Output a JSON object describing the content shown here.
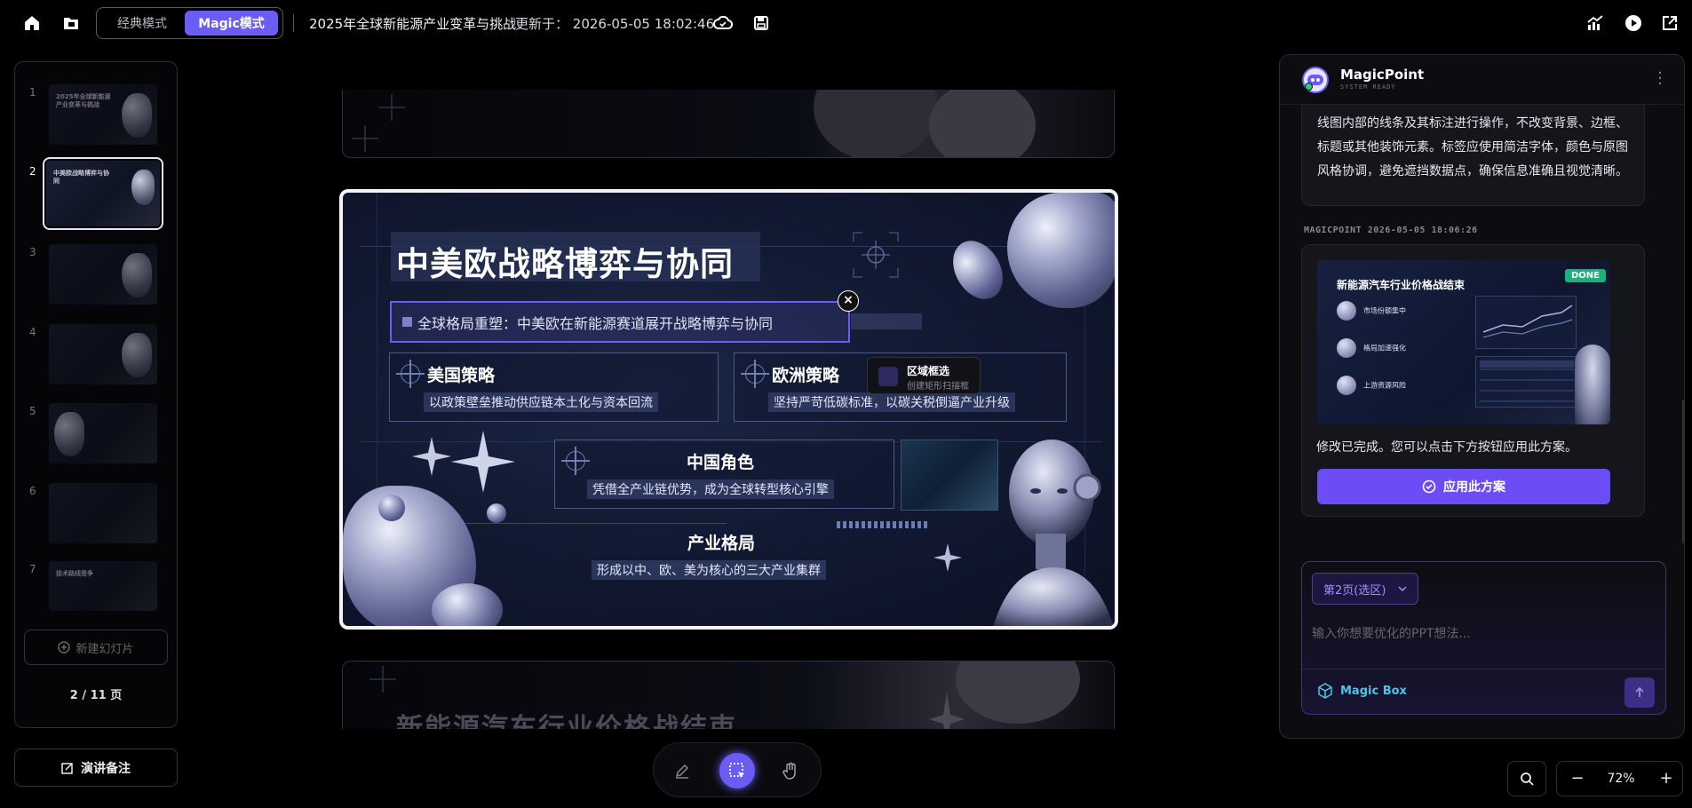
{
  "topbar": {
    "mode_classic": "经典模式",
    "mode_magic": "Magic模式",
    "doc_title": "2025年全球新能源产业变革与挑战",
    "updated_label": "更新于：",
    "updated_time": "2026-05-05 18:02:46"
  },
  "thumbnails": {
    "items": [
      {
        "num": "1",
        "title": "2025年全球新能源产业变革与挑战"
      },
      {
        "num": "2",
        "title": "中美欧战略博弈与协同"
      },
      {
        "num": "3",
        "title": ""
      },
      {
        "num": "4",
        "title": ""
      },
      {
        "num": "5",
        "title": ""
      },
      {
        "num": "6",
        "title": ""
      },
      {
        "num": "7",
        "title": "技术路线竞争"
      }
    ],
    "active_index": 2,
    "new_slide_label": "新建幻灯片",
    "page_count": "2 / 11 页"
  },
  "notes_label": "演讲备注",
  "slide": {
    "title": "中美欧战略博弈与协同",
    "subtitle": "全球格局重塑：中美欧在新能源赛道展开战略博弈与协同",
    "us": {
      "heading": "美国策略",
      "text": "以政策壁垒推动供应链本土化与资本回流"
    },
    "eu": {
      "heading": "欧洲策略",
      "text": "坚持严苛低碳标准，以碳关税倒逼产业升级"
    },
    "cn": {
      "heading": "中国角色",
      "text": "凭借全产业链优势，成为全球转型核心引擎"
    },
    "industry": {
      "heading": "产业格局",
      "text": "形成以中、欧、美为核心的三大产业集群"
    }
  },
  "tooltip": {
    "title": "区域框选",
    "sub": "创建矩形扫描框"
  },
  "next_slide_title": "新能源汽车行业价格战结束",
  "zoom": {
    "value": "72%",
    "minus": "−",
    "plus": "+"
  },
  "ai": {
    "name": "MagicPoint",
    "status": "SYSTEM READY",
    "msg1": "线图内部的线条及其标注进行操作，不改变背景、边框、标题或其他装饰元素。标签应使用简洁字体，颜色与原图风格协调，避免遮挡数据点，确保信息准确且视觉清晰。",
    "meta": "MAGICPOINT 2026-05-05 18:06:26",
    "preview": {
      "title": "新能源汽车行业价格战结束",
      "badge": "DONE",
      "items": [
        "市场份额集中",
        "格局加速强化",
        "上游资源风险"
      ]
    },
    "done_text": "修改已完成。您可以点击下方按钮应用此方案。",
    "apply_label": "应用此方案",
    "page_select": "第2页(选区)",
    "input_placeholder": "输入你想要优化的PPT想法...",
    "magic_box": "Magic Box"
  },
  "colors": {
    "accent": "#6b5cf6",
    "done_green": "#18b37a",
    "magic_box": "#4fc3e8"
  }
}
